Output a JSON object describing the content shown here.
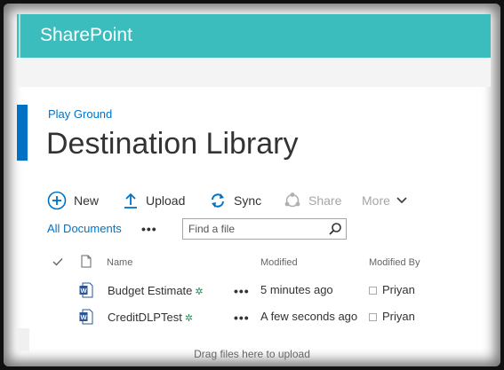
{
  "app": {
    "brand": "SharePoint"
  },
  "breadcrumb": "Play Ground",
  "page_title": "Destination Library",
  "commands": {
    "new": "New",
    "upload": "Upload",
    "sync": "Sync",
    "share": "Share",
    "more": "More"
  },
  "view": {
    "label": "All Documents",
    "ellipsis": "•••"
  },
  "search": {
    "placeholder": "Find a file"
  },
  "columns": {
    "name": "Name",
    "modified": "Modified",
    "modified_by": "Modified By"
  },
  "files": [
    {
      "name": "Budget Estimate",
      "new_marker": "✲",
      "modified": "5 minutes ago",
      "modified_by": "Priyan",
      "menu": "•••"
    },
    {
      "name": "CreditDLPTest",
      "new_marker": "✲",
      "modified": "A few seconds ago",
      "modified_by": "Priyan",
      "menu": "•••"
    }
  ],
  "drop_hint": "Drag files here to upload",
  "colors": {
    "suite_bar": "#3bbdbd",
    "accent": "#0072c6",
    "link": "#0072c6"
  }
}
